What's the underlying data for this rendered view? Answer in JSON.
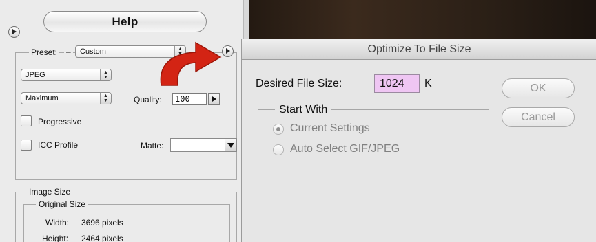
{
  "left_panel": {
    "help_label": "Help",
    "preset_label": "Preset:",
    "preset_value": "Custom",
    "format_value": "JPEG",
    "quality_preset_value": "Maximum",
    "quality_label": "Quality:",
    "quality_value": "100",
    "progressive_label": "Progressive",
    "icc_profile_label": "ICC Profile",
    "matte_label": "Matte:",
    "matte_value": "",
    "image_size": {
      "title": "Image Size",
      "original_size_title": "Original Size",
      "width_label": "Width:",
      "width_value": "3696 pixels",
      "height_label": "Height:",
      "height_value": "2464 pixels"
    }
  },
  "dialog": {
    "title": "Optimize To File Size",
    "desired_size_label": "Desired File Size:",
    "desired_size_value": "1024",
    "unit": "K",
    "ok_label": "OK",
    "cancel_label": "Cancel",
    "start_with": {
      "title": "Start With",
      "options": [
        {
          "label": "Current Settings",
          "selected": true
        },
        {
          "label": "Auto Select GIF/JPEG",
          "selected": false
        }
      ]
    }
  },
  "colors": {
    "arrow": "#d32414",
    "size_field_bg": "#efc6f3"
  }
}
